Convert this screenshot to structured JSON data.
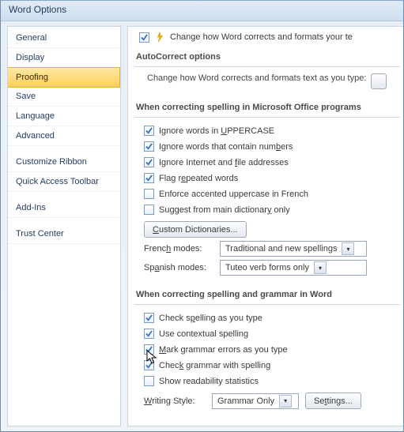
{
  "window": {
    "title": "Word Options"
  },
  "sidebar": {
    "items": [
      {
        "label": "General"
      },
      {
        "label": "Display"
      },
      {
        "label": "Proofing"
      },
      {
        "label": "Save"
      },
      {
        "label": "Language"
      },
      {
        "label": "Advanced"
      },
      {
        "label": "Customize Ribbon"
      },
      {
        "label": "Quick Access Toolbar"
      },
      {
        "label": "Add-Ins"
      },
      {
        "label": "Trust Center"
      }
    ]
  },
  "top": {
    "text": "Change how Word corrects and formats your te"
  },
  "autocorrect": {
    "heading": "AutoCorrect options",
    "desc": "Change how Word corrects and formats text as you type:"
  },
  "spelling_office": {
    "heading": "When correcting spelling in Microsoft Office programs",
    "items": [
      "Ignore words in UPPERCASE",
      "Ignore words that contain numbers",
      "Ignore Internet and file addresses",
      "Flag repeated words",
      "Enforce accented uppercase in French",
      "Suggest from main dictionary only"
    ],
    "custom_dict": "Custom Dictionaries...",
    "french_label": "French modes:",
    "french_value": "Traditional and new spellings",
    "spanish_label": "Spanish modes:",
    "spanish_value": "Tuteo verb forms only"
  },
  "spelling_word": {
    "heading": "When correcting spelling and grammar in Word",
    "items": [
      "Check spelling as you type",
      "Use contextual spelling",
      "Mark grammar errors as you type",
      "Check grammar with spelling",
      "Show readability statistics"
    ],
    "writing_style_label": "Writing Style:",
    "writing_style_value": "Grammar Only",
    "settings": "Settings..."
  }
}
